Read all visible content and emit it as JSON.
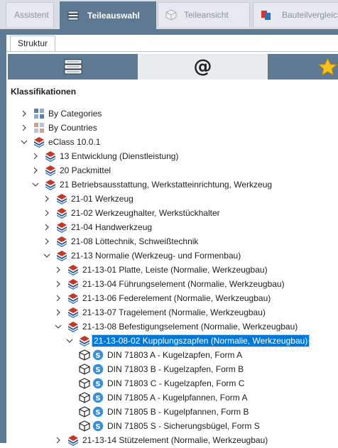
{
  "tabs": [
    {
      "label": "Assistent",
      "icon": "none",
      "active": false
    },
    {
      "label": "Teileauswahl",
      "icon": "parts-stack-icon",
      "active": true
    },
    {
      "label": "Teileansicht",
      "icon": "cube-view-icon",
      "active": false
    },
    {
      "label": "Bauteilvergleich",
      "icon": "compare-icon",
      "active": false
    }
  ],
  "subtab": "Struktur",
  "viewbar": {
    "at_symbol": "@"
  },
  "section_title": "Klassifikationen",
  "colors": {
    "accent": "#5d7a92",
    "selection": "#0078d7",
    "stack_red": "#c0392b",
    "stack_blue": "#1f4e8c",
    "badge_blue": "#3b8fd6"
  },
  "tree": [
    {
      "level": 1,
      "expanded": false,
      "icon": "categories-icon",
      "label": "By Categories"
    },
    {
      "level": 1,
      "expanded": false,
      "icon": "countries-icon",
      "label": "By Countries"
    },
    {
      "level": 1,
      "expanded": true,
      "icon": "eclass-stack-icon",
      "label": "eClass 10.0.1"
    },
    {
      "level": 2,
      "expanded": false,
      "icon": "eclass-stack-icon",
      "label": "13 Entwicklung (Dienstleistung)"
    },
    {
      "level": 2,
      "expanded": false,
      "icon": "eclass-stack-icon",
      "label": "20 Packmittel"
    },
    {
      "level": 2,
      "expanded": true,
      "icon": "eclass-stack-icon",
      "label": "21 Betriebsausstattung, Werkstatteinrichtung, Werkzeug"
    },
    {
      "level": 3,
      "expanded": false,
      "icon": "eclass-stack-icon",
      "label": "21-01 Werkzeug"
    },
    {
      "level": 3,
      "expanded": false,
      "icon": "eclass-stack-icon",
      "label": "21-02 Werkzeughalter, Werkstückhalter"
    },
    {
      "level": 3,
      "expanded": false,
      "icon": "eclass-stack-icon",
      "label": "21-04 Handwerkzeug"
    },
    {
      "level": 3,
      "expanded": false,
      "icon": "eclass-stack-icon",
      "label": "21-08 Löttechnik, Schweißtechnik"
    },
    {
      "level": 3,
      "expanded": true,
      "icon": "eclass-stack-icon",
      "label": "21-13 Normalie (Werkzeug- und Formenbau)"
    },
    {
      "level": 4,
      "expanded": false,
      "icon": "eclass-stack-icon",
      "label": "21-13-01 Platte, Leiste (Normalie, Werkzeugbau)"
    },
    {
      "level": 4,
      "expanded": false,
      "icon": "eclass-stack-icon",
      "label": "21-13-04 Führungselement (Normalie, Werkzeugbau)"
    },
    {
      "level": 4,
      "expanded": false,
      "icon": "eclass-stack-icon",
      "label": "21-13-06 Federelement (Normalie, Werkzeugbau)"
    },
    {
      "level": 4,
      "expanded": false,
      "icon": "eclass-stack-icon",
      "label": "21-13-07 Tragelement (Normalie, Werkzeugbau)"
    },
    {
      "level": 4,
      "expanded": true,
      "icon": "eclass-stack-icon",
      "label": "21-13-08 Befestigungselement (Normalie, Werkzeugbau)"
    },
    {
      "level": 5,
      "expanded": true,
      "icon": "eclass-stack-icon",
      "label": "21-13-08-02 Kupplungszapfen (Normalie, Werkzeugbau)",
      "selected": true
    },
    {
      "level": 6,
      "leaf": true,
      "icon": "part-cube-icon",
      "label": "DIN 71803 A - Kugelzapfen, Form A"
    },
    {
      "level": 6,
      "leaf": true,
      "icon": "part-cube-icon",
      "label": "DIN 71803 B - Kugelzapfen, Form B"
    },
    {
      "level": 6,
      "leaf": true,
      "icon": "part-cube-icon",
      "label": "DIN 71803 C - Kugelzapfen, Form C"
    },
    {
      "level": 6,
      "leaf": true,
      "icon": "part-cube-icon",
      "label": "DIN 71805 A - Kugelpfannen, Form A"
    },
    {
      "level": 6,
      "leaf": true,
      "icon": "part-cube-icon",
      "label": "DIN 71805 B - Kugelpfannen, Form B"
    },
    {
      "level": 6,
      "leaf": true,
      "icon": "part-cube-icon",
      "label": "DIN 71805 S - Sicherungsbügel, Form S"
    },
    {
      "level": 4,
      "expanded": false,
      "icon": "eclass-stack-icon",
      "label": "21-13-14 Stützelement (Normalie, Werkzeugbau)"
    }
  ]
}
